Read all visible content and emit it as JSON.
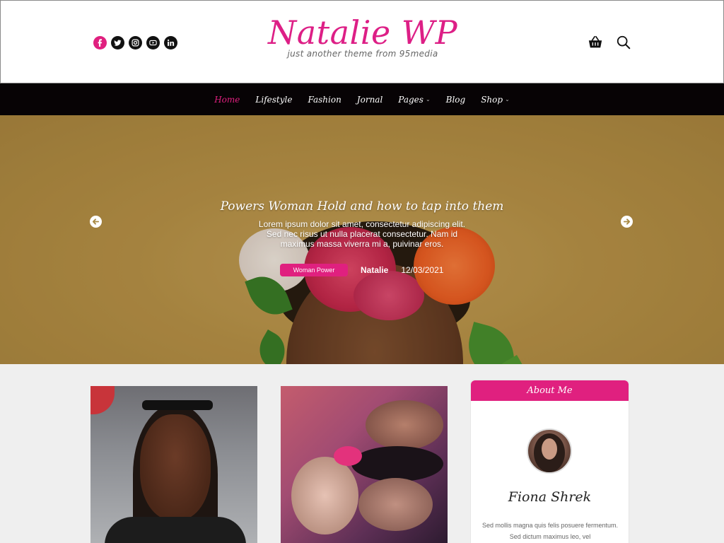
{
  "header": {
    "logo_text": "Natalie WP",
    "tagline": "just another theme from 95media",
    "social_icons": [
      "facebook-icon",
      "twitter-icon",
      "instagram-icon",
      "youtube-icon",
      "linkedin-icon"
    ],
    "tools": [
      "basket-icon",
      "search-icon"
    ]
  },
  "nav": {
    "items": [
      {
        "label": "Home",
        "active": true
      },
      {
        "label": "Lifestyle"
      },
      {
        "label": "Fashion"
      },
      {
        "label": "Jornal"
      },
      {
        "label": "Pages",
        "has_dropdown": true
      },
      {
        "label": "Blog"
      },
      {
        "label": "Shop",
        "has_dropdown": true
      }
    ]
  },
  "hero": {
    "title": "Powers Woman Hold and how to tap into them",
    "excerpt": "Lorem ipsum dolor sit amet, consectetur adipiscing elit. Sed nec risus ut nulla placerat consectetur. Nam id maximus massa viverra mi a, puivinar eros.",
    "category": "Woman Power",
    "author": "Natalie",
    "date": "12/03/2021",
    "prev_icon": "arrow-left-icon",
    "next_icon": "arrow-right-icon"
  },
  "about": {
    "heading": "About Me",
    "name": "Fiona Shrek",
    "bio": "Sed mollis magna quis felis posuere fermentum. Sed dictum maximus leo, vel"
  },
  "colors": {
    "accent": "#e0207f",
    "nav_bg": "#070305",
    "page_bg": "#efefef"
  }
}
